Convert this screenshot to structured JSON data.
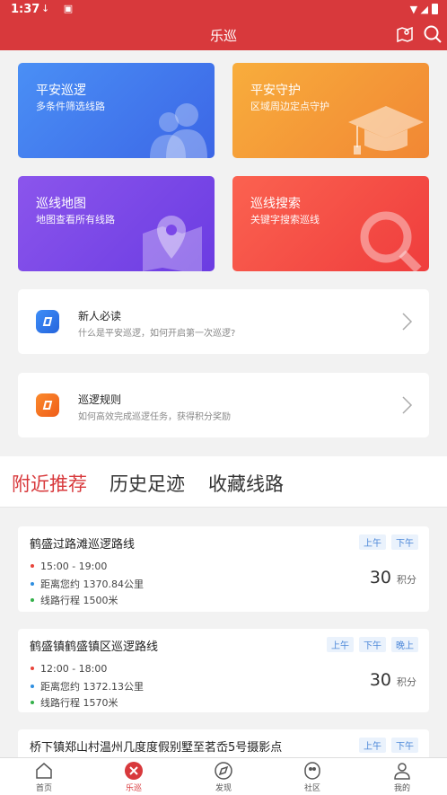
{
  "status": {
    "time": "1:37"
  },
  "header": {
    "title": "乐巡"
  },
  "grid": [
    {
      "title": "平安巡逻",
      "subtitle": "多条件筛选线路"
    },
    {
      "title": "平安守护",
      "subtitle": "区域周边定点守护"
    },
    {
      "title": "巡线地图",
      "subtitle": "地图查看所有线路"
    },
    {
      "title": "巡线搜索",
      "subtitle": "关键字搜索巡线"
    }
  ],
  "info": [
    {
      "title": "新人必读",
      "subtitle": "什么是平安巡逻，如何开启第一次巡逻?"
    },
    {
      "title": "巡逻规则",
      "subtitle": "如何高效完成巡逻任务，获得积分奖励"
    }
  ],
  "tabs": [
    "附近推荐",
    "历史足迹",
    "收藏线路"
  ],
  "routes": [
    {
      "name": "鹤盛过路滩巡逻路线",
      "tags": [
        "上午",
        "下午"
      ],
      "time": "15:00 - 19:00",
      "distance": "距离您约 1370.84公里",
      "length": "线路行程 1500米",
      "points": "30",
      "unit": "积分"
    },
    {
      "name": "鹤盛镇鹤盛镇区巡逻路线",
      "tags": [
        "上午",
        "下午",
        "晚上"
      ],
      "time": "12:00 - 18:00",
      "distance": "距离您约 1372.13公里",
      "length": "线路行程 1570米",
      "points": "30",
      "unit": "积分"
    },
    {
      "name": "桥下镇郑山村温州几度度假别墅至茗岙5号摄影点",
      "tags": [
        "上午",
        "下午"
      ]
    }
  ],
  "nav": [
    "首页",
    "乐巡",
    "发现",
    "社区",
    "我的"
  ],
  "colors": {
    "brand": "#d8393c",
    "blue": "#3c66e6",
    "orange": "#f18734",
    "purple": "#6b3ce2",
    "red": "#ef3d3d"
  }
}
